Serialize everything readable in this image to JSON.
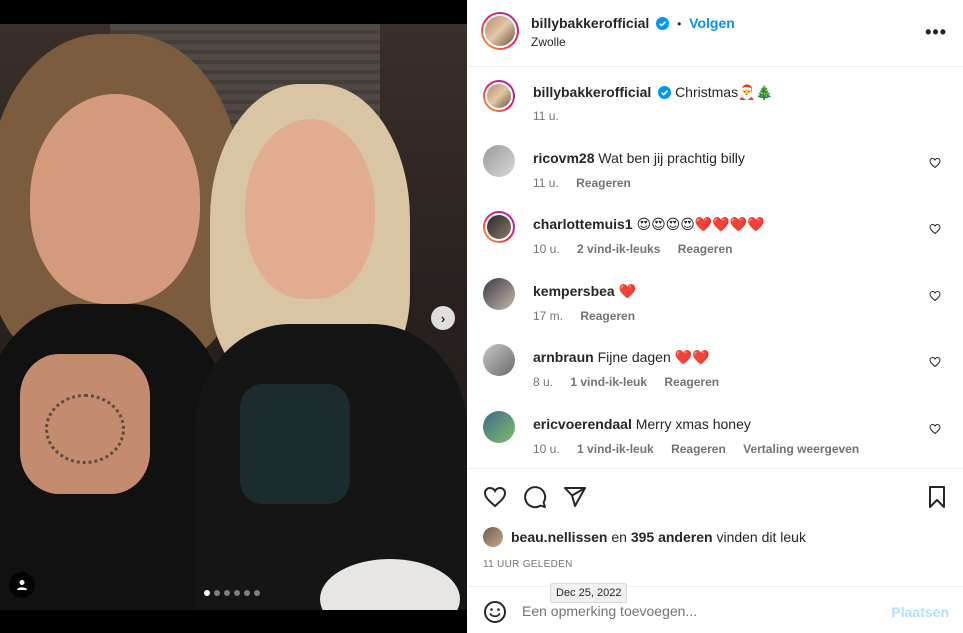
{
  "post": {
    "username": "billybakkerofficial",
    "follow_label": "Volgen",
    "separator": "•",
    "location": "Zwolle",
    "more_label": "•••"
  },
  "media": {
    "slide_count": 6,
    "active_slide": 1
  },
  "caption": {
    "username": "billybakkerofficial",
    "text": "Christmas🎅🎄",
    "time": "11 u."
  },
  "comments": [
    {
      "username": "ricovm28",
      "text": "Wat ben jij prachtig billy",
      "time": "11 u.",
      "likes": "",
      "reply": "Reageren",
      "translate": ""
    },
    {
      "username": "charlottemuis1",
      "text": "😍😍😍😍❤️❤️❤️❤️",
      "time": "10 u.",
      "likes": "2 vind-ik-leuks",
      "reply": "Reageren",
      "translate": ""
    },
    {
      "username": "kempersbea",
      "text": "❤️",
      "time": "17 m.",
      "likes": "",
      "reply": "Reageren",
      "translate": ""
    },
    {
      "username": "arnbraun",
      "text": "Fijne dagen ❤️❤️",
      "time": "8 u.",
      "likes": "1 vind-ik-leuk",
      "reply": "Reageren",
      "translate": ""
    },
    {
      "username": "ericvoerendaal",
      "text": "Merry xmas honey",
      "time": "10 u.",
      "likes": "1 vind-ik-leuk",
      "reply": "Reageren",
      "translate": "Vertaling weergeven"
    }
  ],
  "likes": {
    "user": "beau.nellissen",
    "middle": " en ",
    "count": "395 anderen",
    "suffix": " vinden dit leuk"
  },
  "timestamp": {
    "relative": "11 UUR GELEDEN",
    "tooltip": "Dec 25, 2022"
  },
  "compose": {
    "placeholder": "Een opmerking toevoegen...",
    "post_label": "Plaatsen"
  },
  "colors": {
    "accent": "#0095f6",
    "post_disabled": "#b2dffc",
    "muted": "#737373",
    "like_red": "#ed4956"
  }
}
